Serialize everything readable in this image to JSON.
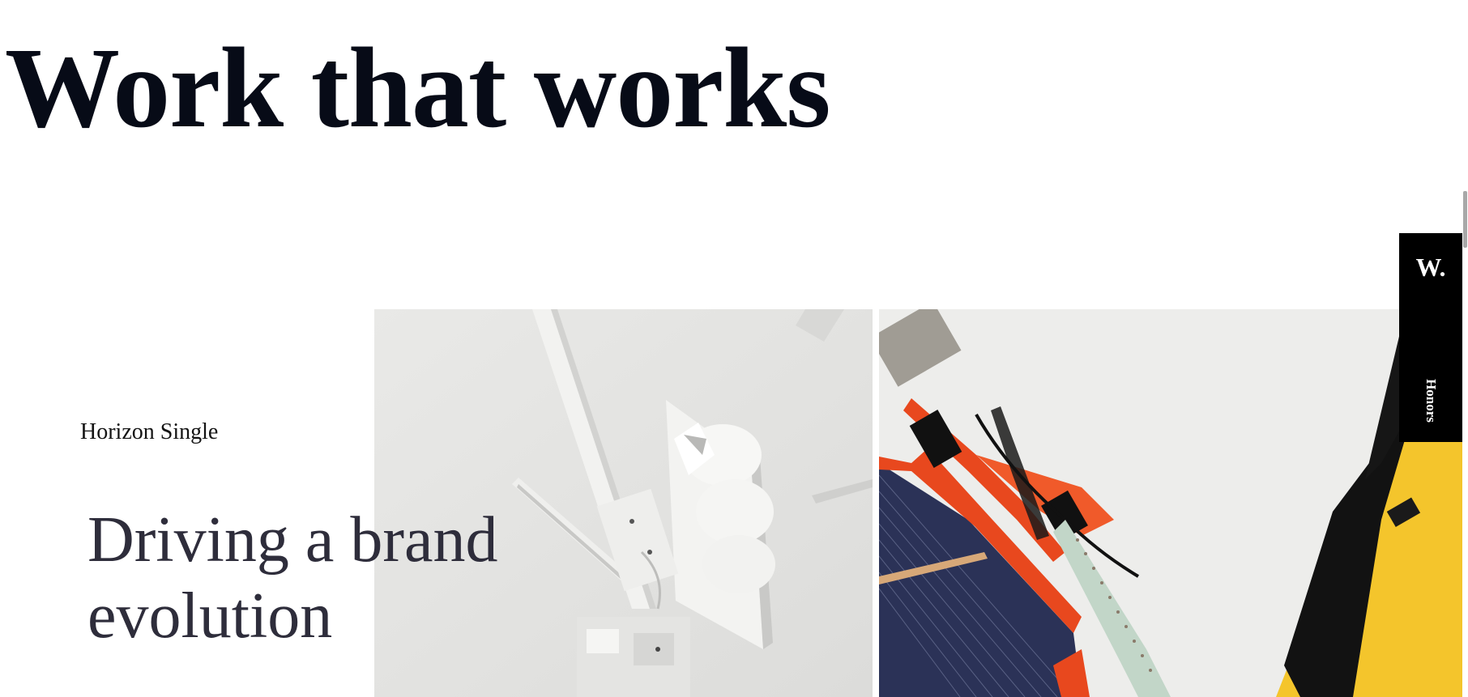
{
  "page": {
    "headline": "Work that works"
  },
  "project": {
    "client": "Horizon Single",
    "title_line1": "Driving a brand",
    "title_line2": "evolution",
    "images": [
      "white-antenna-mount-photo",
      "orange-solar-unit-photo"
    ]
  },
  "side_tab": {
    "logo": "W.",
    "label": "Honors"
  },
  "colors": {
    "headline": "#070b17",
    "title": "#2e2d3b",
    "tab_background": "#000000",
    "accent_orange": "#e8481e",
    "accent_yellow": "#f4c52c"
  }
}
